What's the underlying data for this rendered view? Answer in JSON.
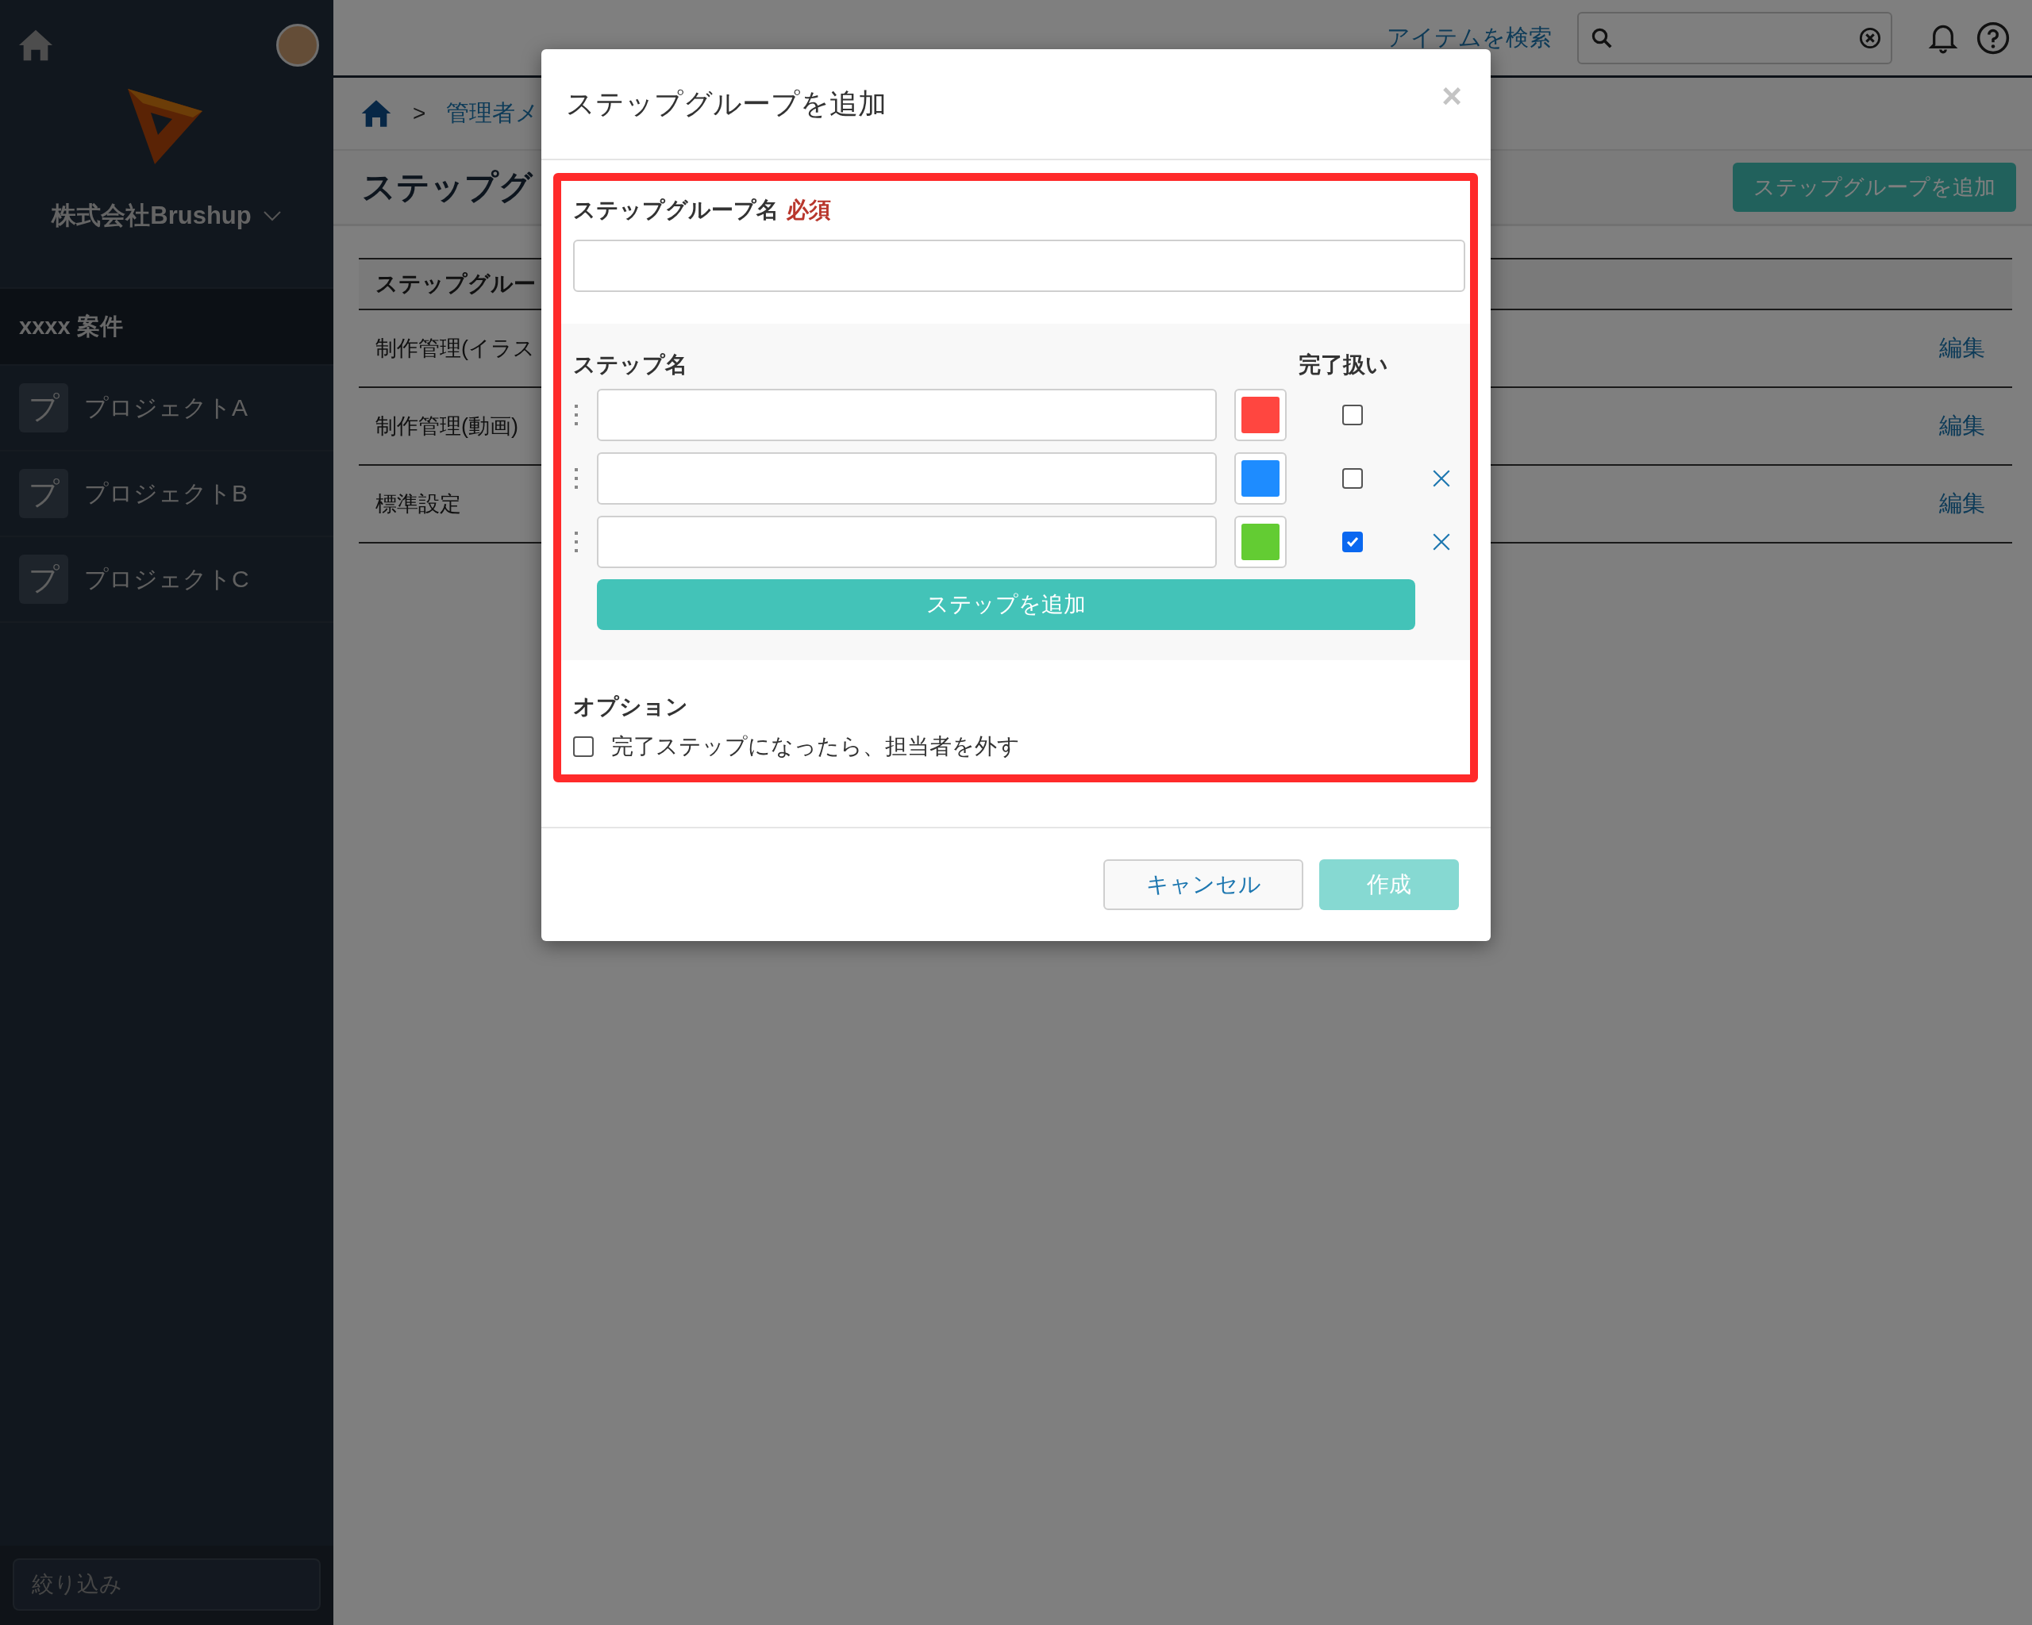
{
  "sidebar": {
    "company": "株式会社Brushup",
    "section": "xxxx 案件",
    "projects": [
      {
        "icon": "プ",
        "name": "プロジェクトA"
      },
      {
        "icon": "プ",
        "name": "プロジェクトB"
      },
      {
        "icon": "プ",
        "name": "プロジェクトC"
      }
    ],
    "filter": {
      "placeholder": "絞り込み"
    }
  },
  "topbar": {
    "search_link": "アイテムを検索"
  },
  "breadcrumb": {
    "separator": ">",
    "items": [
      "管理者メ"
    ]
  },
  "page": {
    "title": "ステップグ",
    "add_button": "ステップグループを追加"
  },
  "table": {
    "header": "ステップグルー",
    "rows": [
      {
        "name": "制作管理(イラス",
        "action": "編集"
      },
      {
        "name": "制作管理(動画)",
        "action": "編集"
      },
      {
        "name": "標準設定",
        "action": "編集"
      }
    ]
  },
  "dialog": {
    "title": "ステップグループを追加",
    "close": "×",
    "group_name": {
      "label": "ステップグループ名",
      "required": "必須"
    },
    "steps": {
      "name_header": "ステップ名",
      "done_header": "完了扱い",
      "rows": [
        {
          "color": "#ff4640",
          "done": false,
          "removable": false
        },
        {
          "color": "#1e8cff",
          "done": false,
          "removable": true
        },
        {
          "color": "#63cc33",
          "done": true,
          "removable": true
        }
      ],
      "add_button": "ステップを追加"
    },
    "options": {
      "title": "オプション",
      "items": [
        {
          "label": "完了ステップになったら、担当者を外す",
          "checked": false
        }
      ]
    },
    "cancel": "キャンセル",
    "create": {
      "label": "作成",
      "disabled": true
    }
  }
}
